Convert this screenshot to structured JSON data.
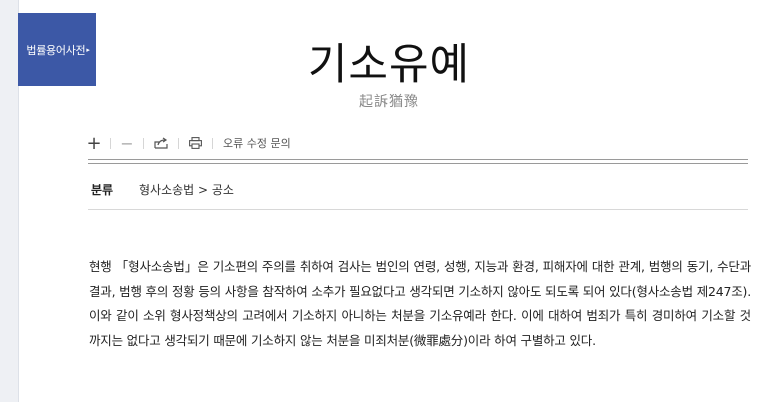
{
  "sidebar": {
    "dict_tab_label": "법률용어사전",
    "dict_tab_arrow": "▸"
  },
  "entry": {
    "title": "기소유예",
    "hanja": "起訴猶豫"
  },
  "toolbar": {
    "icons": [
      "plus-icon",
      "minus-icon",
      "share-icon",
      "print-icon"
    ],
    "report_label": "오류 수정 문의"
  },
  "category": {
    "label": "분류",
    "path": "형사소송법 > 공소"
  },
  "body": {
    "text": "현행 「형사소송법」은 기소편의 주의를 취하여 검사는 범인의 연령, 성행, 지능과 환경, 피해자에 대한 관계, 범행의 동기, 수단과 결과, 범행 후의 정황 등의 사항을 참작하여 소추가 필요없다고 생각되면 기소하지 않아도 되도록 되어 있다(형사소송법 제247조). 이와 같이 소위 형사정책상의 고려에서 기소하지 아니하는 처분을 기소유예라 한다. 이에 대하여 범죄가 특히 경미하여 기소할 것까지는 없다고 생각되기 때문에 기소하지 않는 처분을 미죄처분(微罪處分)이라 하여 구별하고 있다."
  },
  "colors": {
    "tab_bg": "#3c58a6",
    "subtitle": "#8a8a8a"
  }
}
